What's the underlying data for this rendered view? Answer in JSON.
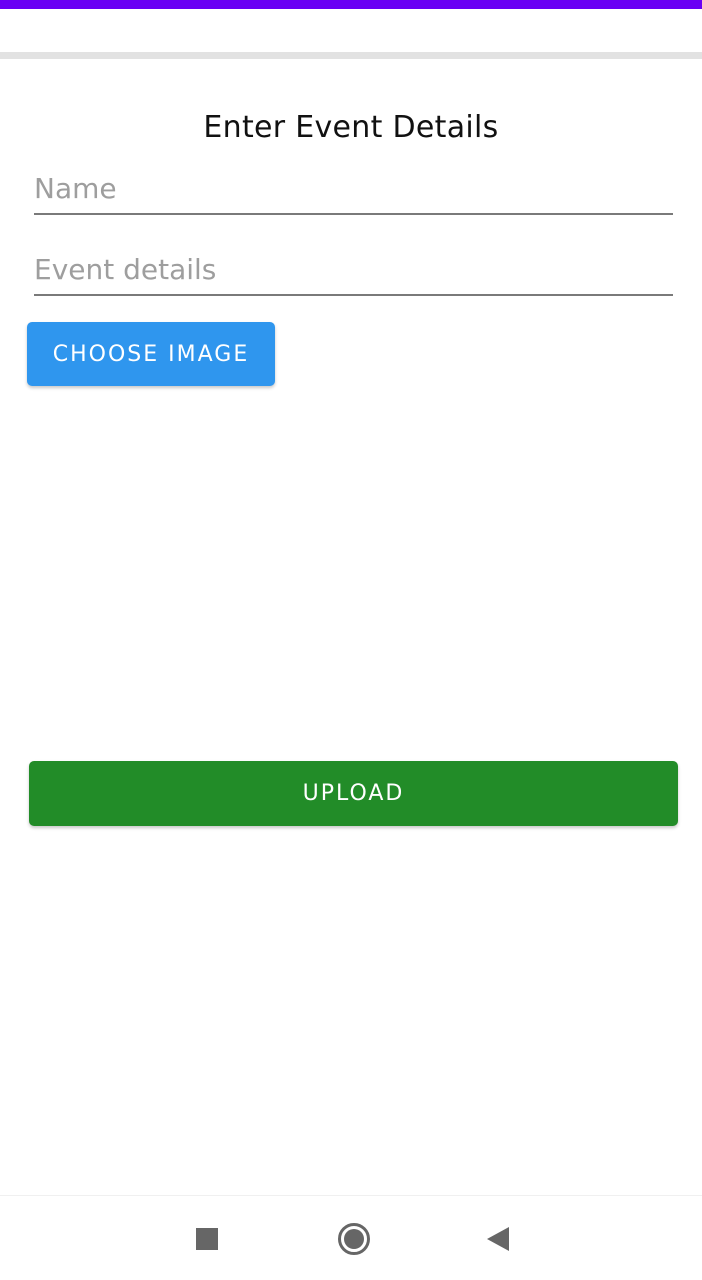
{
  "colors": {
    "status_bar": "#6a00f4",
    "choose_button": "#2f96ee",
    "upload_button": "#228c28",
    "nav_icon": "#666666"
  },
  "main": {
    "title": "Enter Event Details",
    "name_field": {
      "value": "",
      "placeholder": "Name"
    },
    "details_field": {
      "value": "",
      "placeholder": "Event details"
    },
    "choose_image_label": "CHOOSE IMAGE",
    "upload_label": "UPLOAD"
  },
  "nav_bar": {
    "icons": [
      "recents-square-icon",
      "home-circle-icon",
      "back-triangle-icon"
    ]
  }
}
